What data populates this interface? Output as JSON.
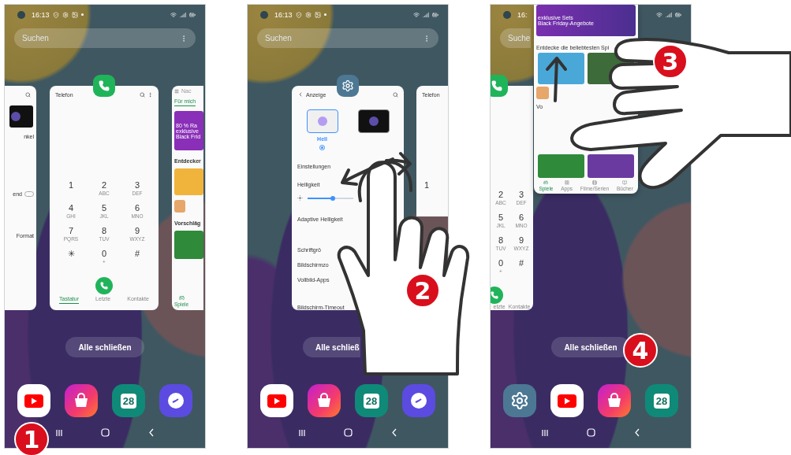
{
  "phones": [
    {
      "status": {
        "time": "16:13",
        "indicators": true
      },
      "search": {
        "placeholder": "Suchen"
      },
      "cards": [
        {
          "kind": "settings_fragment",
          "lines": [
            {
              "text": "nkel"
            },
            {
              "text": "end",
              "switch_on": false
            },
            {
              "text": "Format"
            }
          ]
        },
        {
          "kind": "dialer",
          "app_icon": true,
          "title": "Telefon",
          "keys": [
            {
              "digit": "1"
            },
            {
              "digit": "2",
              "letters": "ABC"
            },
            {
              "digit": "3",
              "letters": "DEF"
            },
            {
              "digit": "4",
              "letters": "GHI"
            },
            {
              "digit": "5",
              "letters": "JKL"
            },
            {
              "digit": "6",
              "letters": "MNO"
            },
            {
              "digit": "7",
              "letters": "PQRS"
            },
            {
              "digit": "8",
              "letters": "TUV"
            },
            {
              "digit": "9",
              "letters": "WXYZ"
            },
            {
              "digit": "✳"
            },
            {
              "digit": "0",
              "letters": "+"
            },
            {
              "digit": "#"
            }
          ],
          "call_button": true,
          "tabs": [
            {
              "label": "Tastatur",
              "selected": true
            },
            {
              "label": "Letzte",
              "selected": false
            },
            {
              "label": "Kontakte",
              "selected": false
            }
          ]
        },
        {
          "kind": "store_fragment",
          "search": {
            "placeholder": "Nac"
          },
          "tab": {
            "label": "Für mich",
            "selected": true
          },
          "banner": [
            "80 % Ra",
            "exklusive",
            "Black Frid"
          ],
          "sections": [
            "Entdecker",
            "Vorschläg"
          ],
          "nav": {
            "label": "Spiele",
            "selected": true
          }
        }
      ],
      "close_all": "Alle schließen",
      "dock": [
        {
          "kind": "youtube"
        },
        {
          "kind": "store"
        },
        {
          "kind": "calendar",
          "label": "28"
        },
        {
          "kind": "clock"
        }
      ]
    },
    {
      "status": {
        "time": "16:13",
        "indicators": true
      },
      "search": {
        "placeholder": "Suchen"
      },
      "cards": [
        {
          "kind": "settings",
          "app_icon": true,
          "title": "Anzeige",
          "themes": [
            {
              "label": "Hell",
              "selected": true,
              "dark": false
            },
            {
              "selected": false,
              "dark": true
            }
          ],
          "rows": [
            {
              "kind": "row",
              "text": "Einstellungen"
            },
            {
              "kind": "slider",
              "text": "Helligkeit",
              "level": 0.55
            },
            {
              "kind": "row",
              "text": "Adaptive Helligkeit"
            },
            {
              "kind": "row",
              "text": "Schriftgrö"
            },
            {
              "kind": "row",
              "text": "Bildschirmzo"
            },
            {
              "kind": "row",
              "text": "Vollbild-Apps"
            },
            {
              "kind": "row",
              "text": "Bildschirm-Timeout"
            }
          ]
        },
        {
          "kind": "dialer",
          "app_icon": false,
          "title": "Telefon",
          "keys": [
            {
              "digit": "1"
            }
          ],
          "call_button": false
        }
      ],
      "close_all": "Alle schließ",
      "dock": [
        {
          "kind": "youtube"
        },
        {
          "kind": "store"
        },
        {
          "kind": "calendar",
          "label": "28"
        },
        {
          "kind": "clock"
        }
      ]
    },
    {
      "status": {
        "time": "16:",
        "indicators": false
      },
      "search": {
        "placeholder": "Suche"
      },
      "cards": [
        {
          "kind": "dialer",
          "app_icon": true,
          "keys": [
            {
              "digit": "2",
              "letters": "ABC"
            },
            {
              "digit": "3",
              "letters": "DEF"
            },
            {
              "digit": "5",
              "letters": "JKL"
            },
            {
              "digit": "6",
              "letters": "MNO"
            },
            {
              "digit": "8",
              "letters": "TUV"
            },
            {
              "digit": "9",
              "letters": "WXYZ"
            },
            {
              "digit": "0",
              "letters": "+"
            },
            {
              "digit": "#"
            }
          ],
          "call_button": true,
          "tabs": [
            {
              "label": "etzte",
              "selected": false
            },
            {
              "label": "Kontakte",
              "selected": false
            }
          ]
        }
      ],
      "lifted_card": {
        "banner": [
          "exklusive Sets",
          "Black Friday-Angebote"
        ],
        "heading": "Entdecke die beliebtesten Spi",
        "section": "Vo",
        "nav": [
          {
            "label": "Spiele",
            "selected": true
          },
          {
            "label": "Apps",
            "selected": false
          },
          {
            "label": "Filme/Serien",
            "selected": false
          },
          {
            "label": "Bücher",
            "selected": false
          }
        ]
      },
      "close_all": "Alle schließen",
      "dock": [
        {
          "kind": "settings"
        },
        {
          "kind": "youtube"
        },
        {
          "kind": "store"
        },
        {
          "kind": "calendar",
          "label": "28"
        }
      ]
    }
  ],
  "steps": [
    {
      "number": "1"
    },
    {
      "number": "2"
    },
    {
      "number": "3"
    },
    {
      "number": "4"
    }
  ]
}
